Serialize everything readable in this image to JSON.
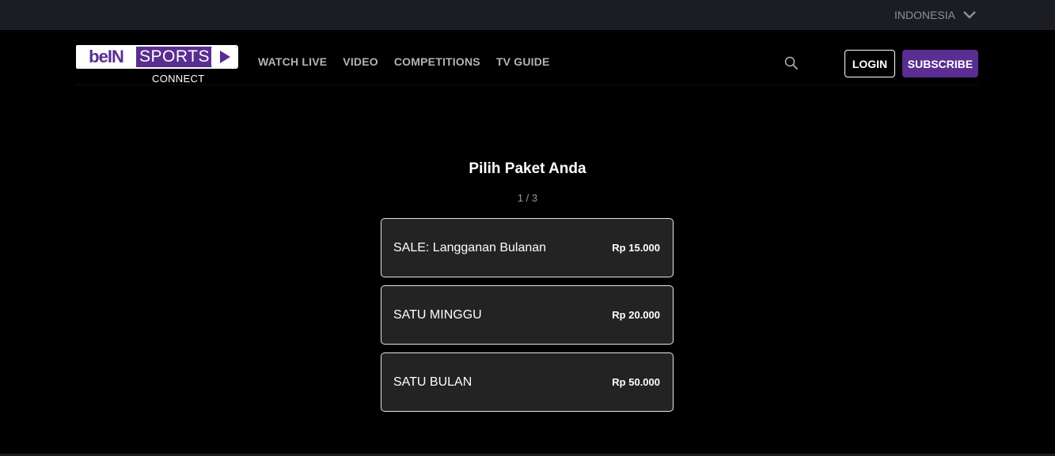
{
  "topbar": {
    "region": "INDONESIA"
  },
  "brand": {
    "bein": "beIN",
    "sports": "SPORTS",
    "connect": "CONNECT"
  },
  "nav": [
    {
      "label": "WATCH LIVE"
    },
    {
      "label": "VIDEO"
    },
    {
      "label": "COMPETITIONS"
    },
    {
      "label": "TV GUIDE"
    }
  ],
  "header": {
    "login": "LOGIN",
    "subscribe": "SUBSCRIBE"
  },
  "main": {
    "title": "Pilih Paket Anda",
    "step": "1 / 3",
    "plans": [
      {
        "name": "SALE: Langganan Bulanan",
        "price": "Rp 15.000"
      },
      {
        "name": "SATU MINGGU",
        "price": "Rp 20.000"
      },
      {
        "name": "SATU BULAN",
        "price": "Rp 50.000"
      }
    ]
  },
  "colors": {
    "accent": "#5a2d91",
    "topbar": "#1b1d22",
    "card": "#232323"
  },
  "icons": {
    "search": "search-icon",
    "dropdown": "chevron-down-icon",
    "play": "play-icon"
  }
}
